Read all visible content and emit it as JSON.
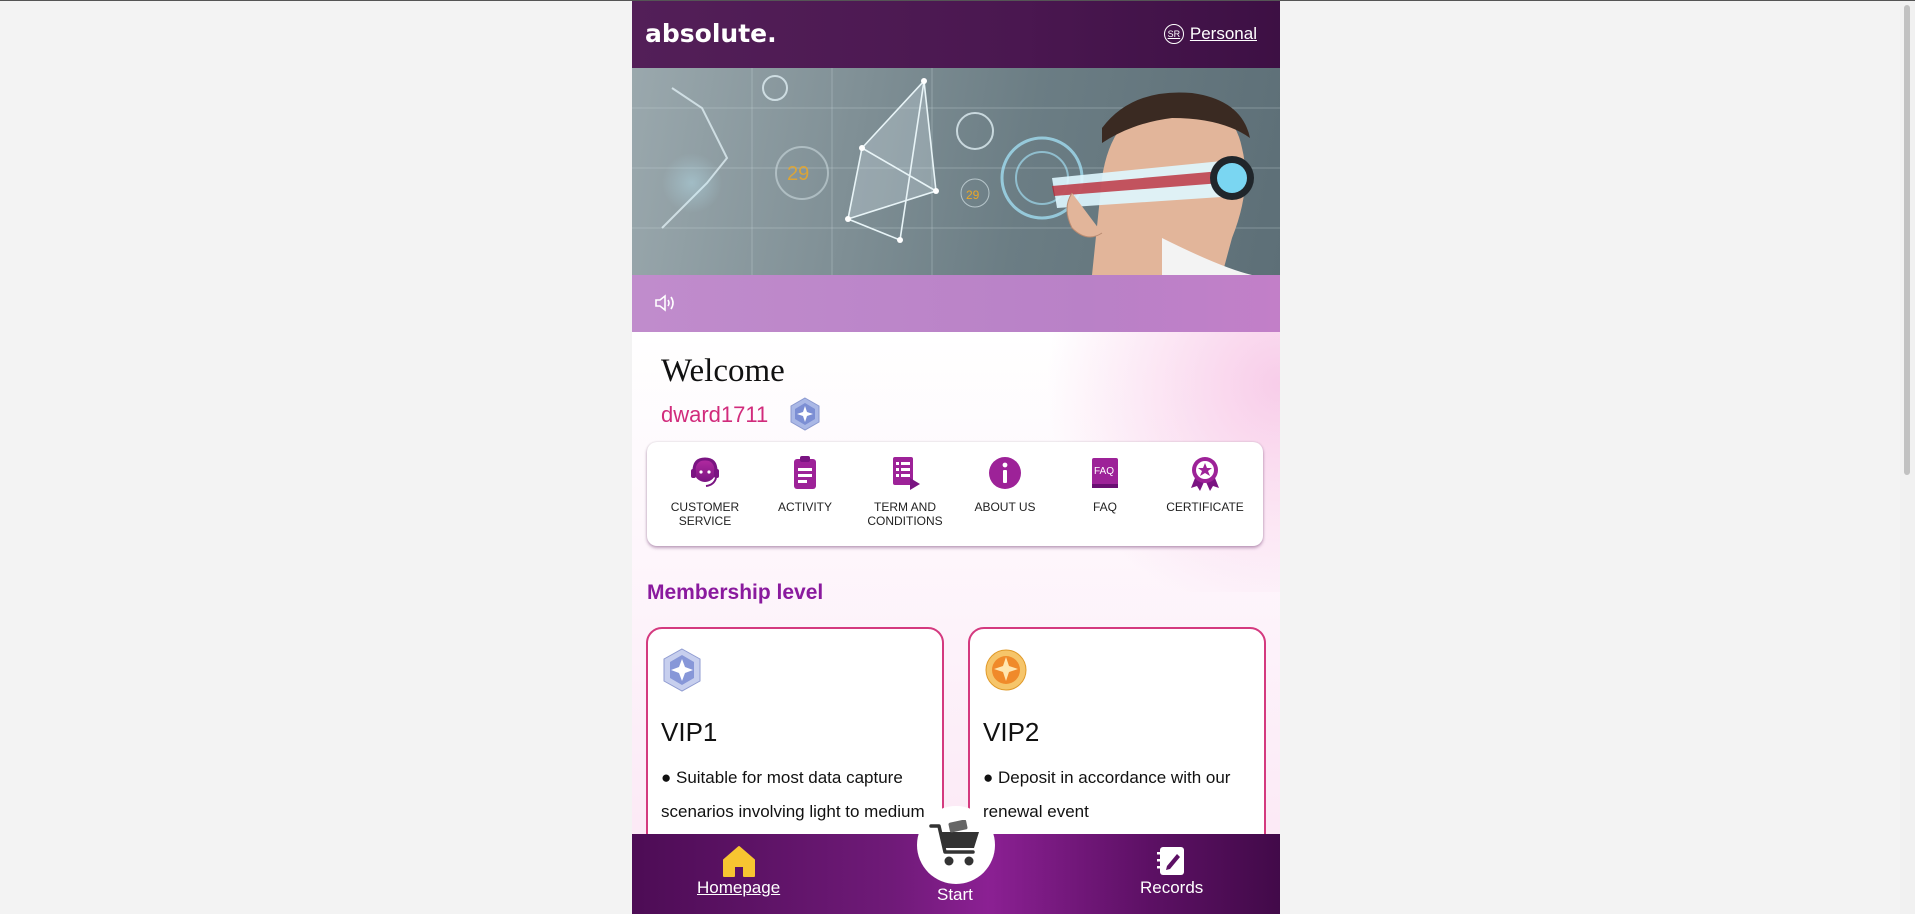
{
  "header": {
    "logo": "absolute.",
    "personal_icon_text": "SR",
    "personal_label": "Personal"
  },
  "welcome": {
    "title": "Welcome",
    "username": "dward1711"
  },
  "menu": [
    {
      "label": "CUSTOMER SERVICE",
      "icon": "headset-icon"
    },
    {
      "label": "ACTIVITY",
      "icon": "clipboard-icon"
    },
    {
      "label": "TERM AND CONDITIONS",
      "icon": "document-list-icon"
    },
    {
      "label": "ABOUT US",
      "icon": "info-icon"
    },
    {
      "label": "FAQ",
      "icon": "faq-book-icon"
    },
    {
      "label": "CERTIFICATE",
      "icon": "award-ribbon-icon"
    }
  ],
  "membership": {
    "title": "Membership level",
    "levels": [
      {
        "name": "VIP1",
        "description": "● Suitable for most data capture scenarios involving light to medium",
        "badge": "silver-star-badge-icon"
      },
      {
        "name": "VIP2",
        "description": "● Deposit in accordance with our renewal event",
        "badge": "gold-star-badge-icon"
      }
    ]
  },
  "bottom_nav": {
    "home": "Homepage",
    "start": "Start",
    "records": "Records"
  },
  "colors": {
    "header_bg": "#4a1750",
    "accent_pink": "#d12b7c",
    "membership_title": "#8a1a9e",
    "notice_bar": "#bb85c8"
  }
}
